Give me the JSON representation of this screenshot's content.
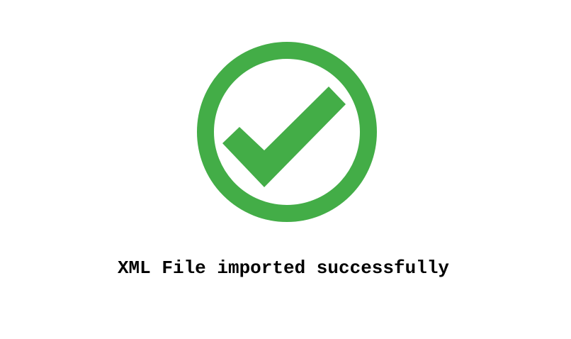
{
  "dialog": {
    "message": "XML File imported successfully",
    "icon": "check-circle-icon",
    "accent_color": "#43ad47",
    "background_color": "#ffffff",
    "text_color": "#000000"
  }
}
